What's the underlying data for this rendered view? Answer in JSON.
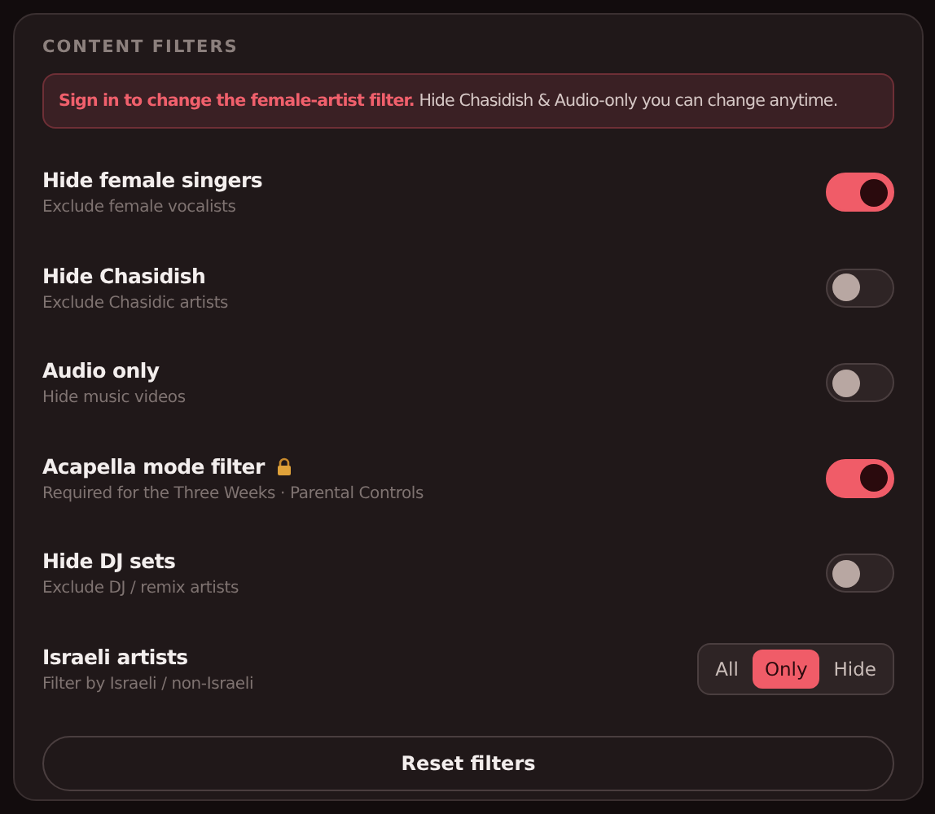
{
  "section_title": "CONTENT FILTERS",
  "notice": "**Sign in to change the female-artist filter.** Hide Chasidish & Audio-only you can change anytime.",
  "filters": [
    {
      "kind": "toggle",
      "title": "Hide female singers",
      "subtitle": "Exclude female vocalists",
      "on": true,
      "locked": false
    },
    {
      "kind": "toggle",
      "title": "Hide Chasidish",
      "subtitle": "Exclude Chasidic artists",
      "on": false,
      "locked": false
    },
    {
      "kind": "toggle",
      "title": "Audio only",
      "subtitle": "Hide music videos",
      "on": false,
      "locked": false
    },
    {
      "kind": "toggle",
      "title": "Acapella mode filter",
      "subtitle": "Required for the Three Weeks · Parental Controls",
      "on": true,
      "locked": true
    },
    {
      "kind": "toggle",
      "title": "Hide DJ sets",
      "subtitle": "Exclude DJ / remix artists",
      "on": false,
      "locked": false
    },
    {
      "kind": "segmented",
      "title": "Israeli artists",
      "subtitle": "Filter by Israeli / non-Israeli",
      "options": [
        {
          "label": "All",
          "selected": false
        },
        {
          "label": "Only",
          "selected": true
        },
        {
          "label": "Hide",
          "selected": false
        }
      ]
    }
  ],
  "reset_button": "Reset filters"
}
